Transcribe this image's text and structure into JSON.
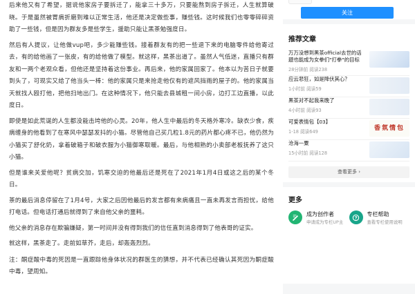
{
  "article": {
    "paragraphs": [
      "后来他又有了希望，据说他家房子要拆迁了，能拿三十多万，只要能熬到房子拆迁，人生就算破晓。于是虽然被胃病折磨到难以正常生活，他还是决定做些事，赚些钱。这时候我们也零零碎碎资助了一些钱，但是因为群友多是些学生，援助只能让黑茶勉强度日。",
      "然后有人提议，让他做vup吧，多少能赚些钱。接着群友有的把一些退下来的电脑零件给他寄过去，有的给他画了一张皮，有的给他做了模型。就这样，黑茶出道了。虽然人气低迷，直播只有群友和一两个老观众看，但他还是坚持着这份事业。再后来，他的家属回家了。他本以为苦日子就要到头了，可现实又给了他当头一棒：他的家属只是来抢走他仅有的遮风挡雨的屋子的。他的家属当天就找人殴打他，把他扫地出门。在这种情况下，他只能去县城租一间小房，边打工边直播，以此度日。",
      "即使是如此荒诞的人生都没能击垮他的心灵。20年，他人生中最后的冬天格外寒冷。缺衣少食，疾病缠身的他看到了在寒风中瑟瑟发抖的小猫。尽管他自己买几粒1.8元的药片都心疼不已，他仍然为小猫买了舒化奶，拿着破箱子和破衣服为小猫御寒取暖。最后，与他相熟的小卖部老板抚养了这只小猫。",
      "但是谁来关爱他呢？贫病交加，饥寒交迫的他最后还是死在了2021年1月4日或这之后的某个冬日。",
      "茶的最后消息停留在了1月4号，大家之后因他最后的发言都有来病痛且一直未再发言而担忧，给他打电话。但电话打通后就得到了来自他父亲的噩耗。",
      "他父亲的消息存在欺骗嫌疑，第一时间并没有得到我们的信任直到消息得到了他表哥的证实。",
      "就这样，黑茶走了。走前如草芥，走后，却轰轰烈烈。"
    ],
    "note": "注：酮症酸中毒的死因是一直跟踪他身体状况的群医生的猜想，并不代表已经确认其死因为酮症酸中毒，望周知。"
  },
  "sidebar": {
    "follow_label": "关注",
    "recommend_title": "推荐文章",
    "items": [
      {
        "title": "万万没想到黑茶official去世的话题也能成为女拳们\"打拳\"的目标",
        "time": "28分钟前",
        "reads": "阅读238"
      },
      {
        "title": "应云悲狂，如是降伏其心？",
        "time": "1小时前",
        "reads": "阅读59"
      },
      {
        "title": "黑茶对不起我来晚了",
        "time": "4小时前",
        "reads": "阅读93"
      },
      {
        "title": "可爱表情包【03】",
        "time": "1-18",
        "reads": "阅读649"
      },
      {
        "title": "沧海一粟",
        "time": "15小时前",
        "reads": "阅读128"
      }
    ],
    "thumb4_text": "香氛情包",
    "view_more_label": "查看更多 ›",
    "more_title": "更多",
    "more": [
      {
        "title": "成为创作者",
        "sub": "申请成为专栏UP主"
      },
      {
        "title": "专栏帮助",
        "sub": "查看专栏使用说明"
      }
    ]
  }
}
